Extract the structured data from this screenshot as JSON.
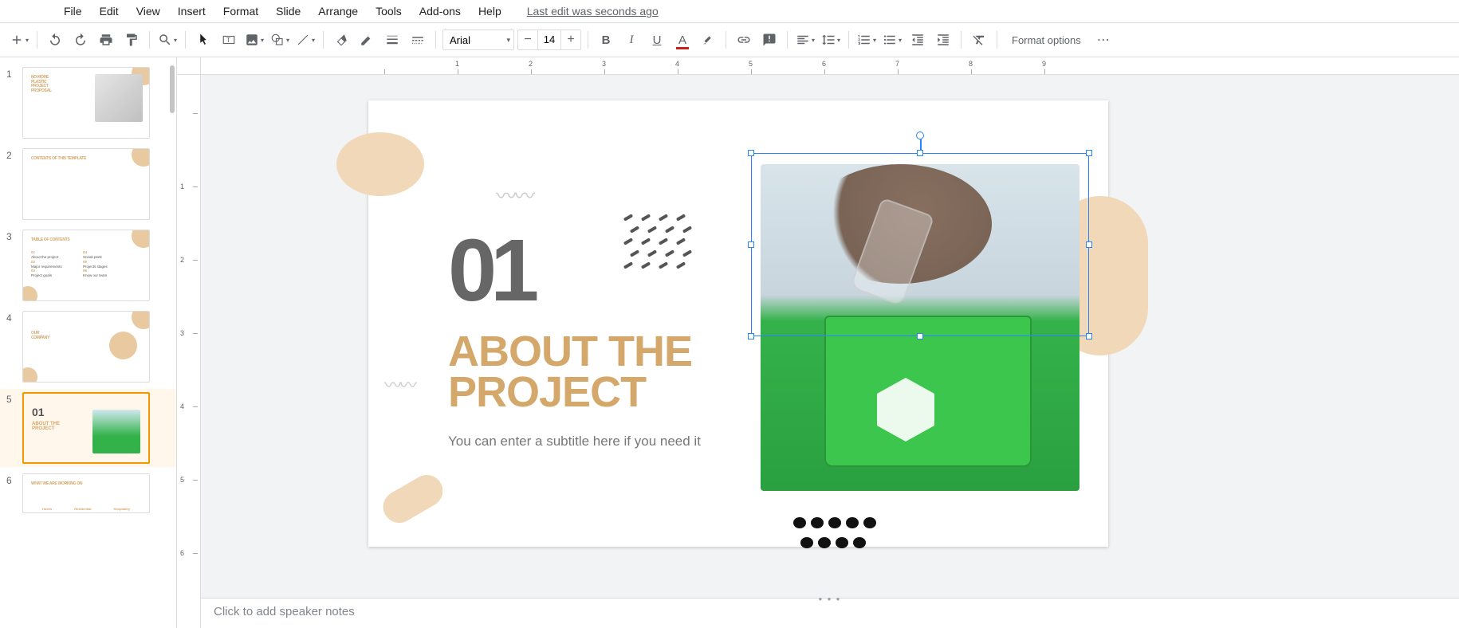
{
  "menus": {
    "file": "File",
    "edit": "Edit",
    "view": "View",
    "insert": "Insert",
    "format": "Format",
    "slide": "Slide",
    "arrange": "Arrange",
    "tools": "Tools",
    "addons": "Add-ons",
    "help": "Help",
    "last_edit": "Last edit was seconds ago"
  },
  "toolbar": {
    "font": "Arial",
    "font_size": "14",
    "format_options": "Format options"
  },
  "slide": {
    "number": "01",
    "title_line1": "ABOUT THE",
    "title_line2": "PROJECT",
    "subtitle": "You can enter a subtitle here if you need it"
  },
  "thumbs": {
    "1": {
      "num": "1",
      "title": "NO MORE\nPLASTIC\nPROJECT\nPROPOSAL"
    },
    "2": {
      "num": "2",
      "title": "CONTENTS OF THIS TEMPLATE"
    },
    "3": {
      "num": "3",
      "title": "TABLE OF CONTENTS",
      "i1": "01",
      "t1": "About the project",
      "i2": "02",
      "t2": "Major requirements",
      "i3": "03",
      "t3": "Project goals",
      "i4": "04",
      "t4": "Sneak peek",
      "i5": "05",
      "t5": "Projects stages",
      "i6": "06",
      "t6": "Know our team"
    },
    "4": {
      "num": "4",
      "title": "OUR\nCOMPANY"
    },
    "5": {
      "num": "5",
      "big": "01",
      "title": "ABOUT THE\nPROJECT"
    },
    "6": {
      "num": "6",
      "title": "WHAT WE ARE WORKING ON",
      "c1": "Hotels",
      "c2": "Residential",
      "c3": "Hospitality"
    }
  },
  "ruler_h": [
    "",
    "1",
    "2",
    "3",
    "4",
    "5",
    "6",
    "7",
    "8",
    "9"
  ],
  "ruler_v": [
    "",
    "1",
    "2",
    "3",
    "4",
    "5",
    "6"
  ],
  "notes": {
    "placeholder": "Click to add speaker notes"
  }
}
